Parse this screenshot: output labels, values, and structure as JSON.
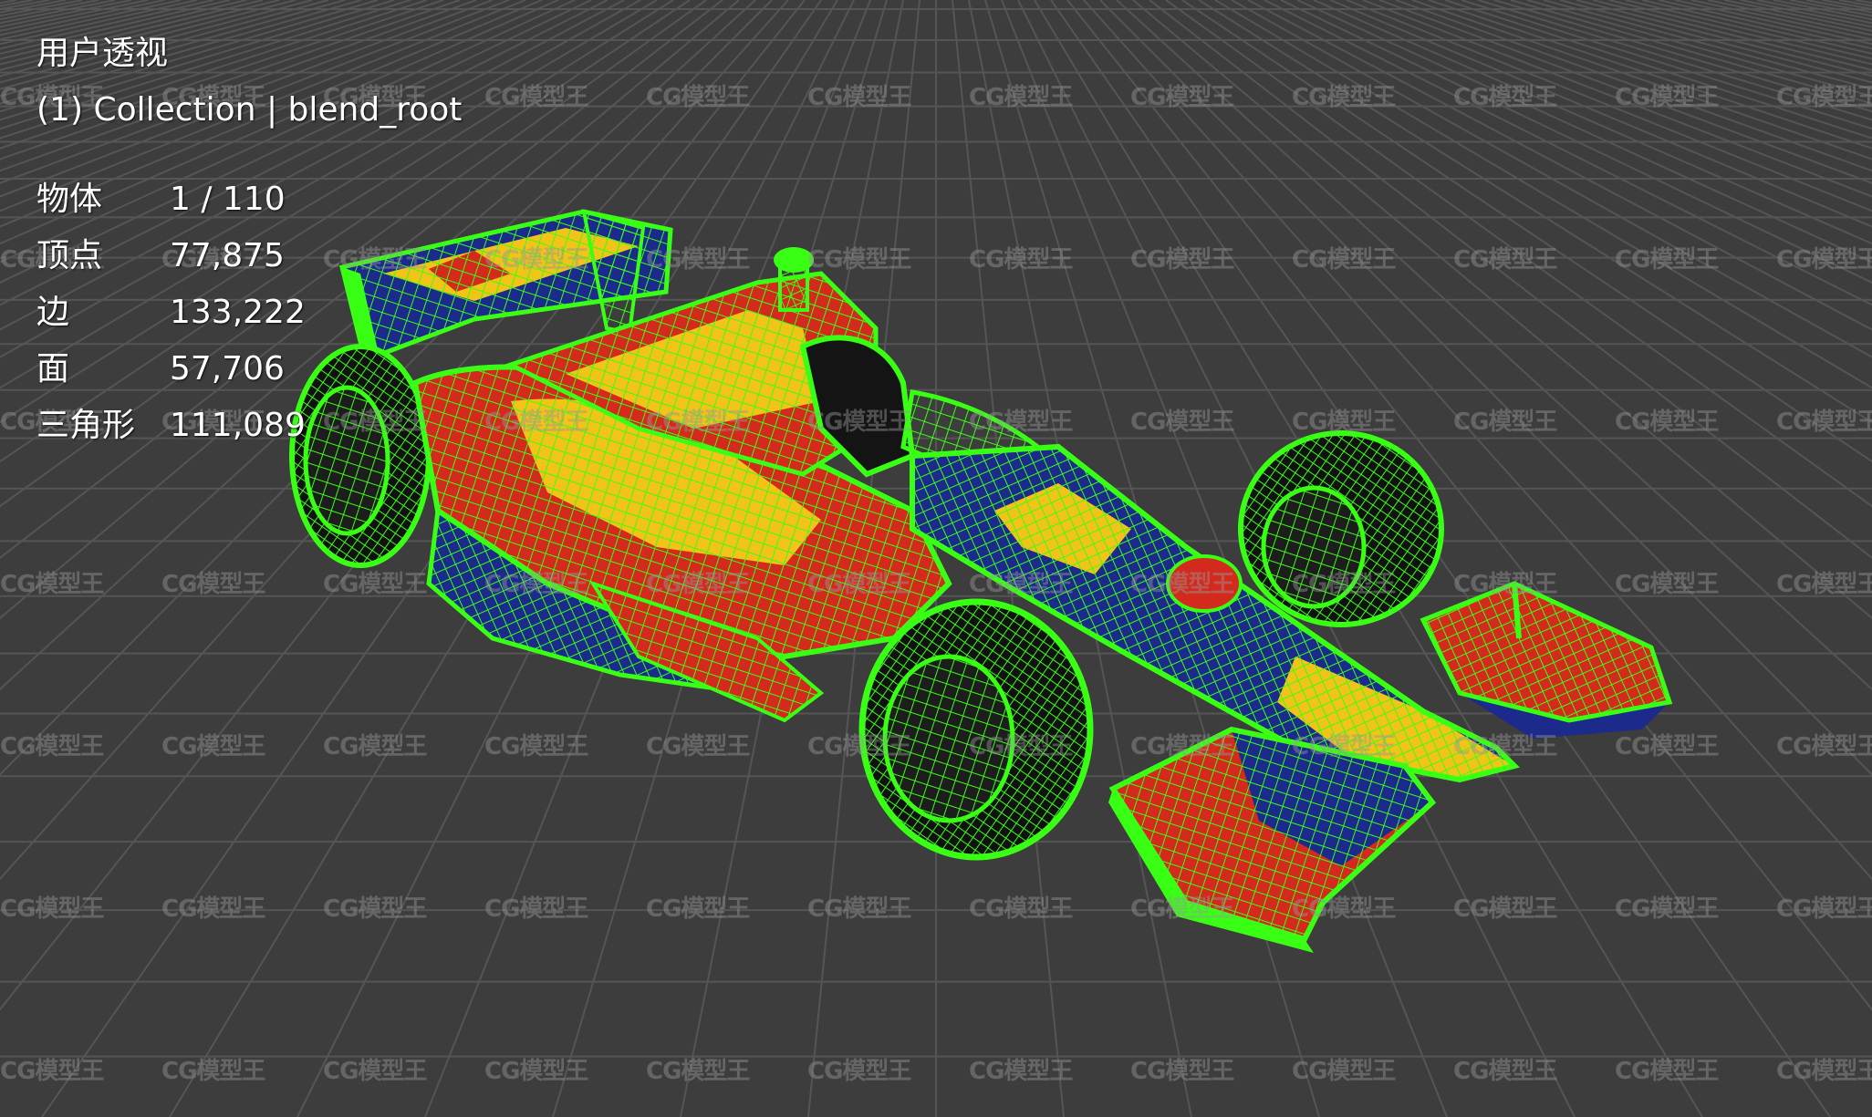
{
  "viewport": {
    "view_name": "用户透视",
    "collection_line": "(1) Collection | blend_root"
  },
  "stats": [
    {
      "label": "物体",
      "value": "1 / 110"
    },
    {
      "label": "顶点",
      "value": "77,875"
    },
    {
      "label": "边",
      "value": "133,222"
    },
    {
      "label": "面",
      "value": "57,706"
    },
    {
      "label": "三角形",
      "value": "111,089"
    }
  ],
  "watermark": "CG模型王",
  "colors": {
    "background": "#3d3d3d",
    "grid_line": "#555555",
    "wireframe": "#39ff14",
    "livery_red": "#d42a1e",
    "livery_blue": "#1c2a8c",
    "livery_yellow": "#f2c417"
  }
}
